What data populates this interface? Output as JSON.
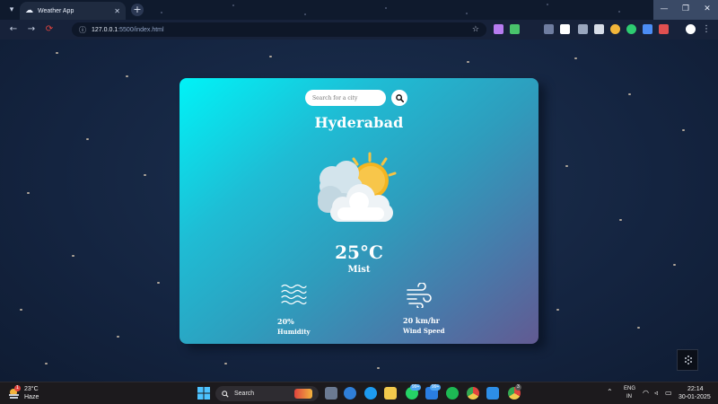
{
  "browser": {
    "tab_title": "Weather App",
    "url_host": "127.0.0.1",
    "url_rest": ":5500/index.html",
    "icons": {
      "back": "back-arrow-icon",
      "forward": "forward-arrow-icon",
      "reload": "reload-icon",
      "bookmark": "star-icon"
    }
  },
  "weather": {
    "search_placeholder": "Search for a city",
    "city": "Hyderabad",
    "temperature": "25°C",
    "condition": "Mist",
    "humidity_value": "20%",
    "humidity_label": "Humidity",
    "wind_value": "20 km/hr",
    "wind_label": "Wind Speed",
    "icon": "cloud-sun-icon",
    "colors": {
      "gradient_start": "#00f3f7",
      "gradient_end": "#625a92",
      "text": "#ffffff"
    }
  },
  "taskbar": {
    "weather_temp": "23°C",
    "weather_condition": "Haze",
    "weather_badge": "1",
    "search_label": "Search",
    "badge_a": "99+",
    "badge_b": "99+",
    "badge_c": "3",
    "lang_line1": "ENG",
    "lang_line2": "IN",
    "time": "22:14",
    "date": "30-01-2025"
  }
}
